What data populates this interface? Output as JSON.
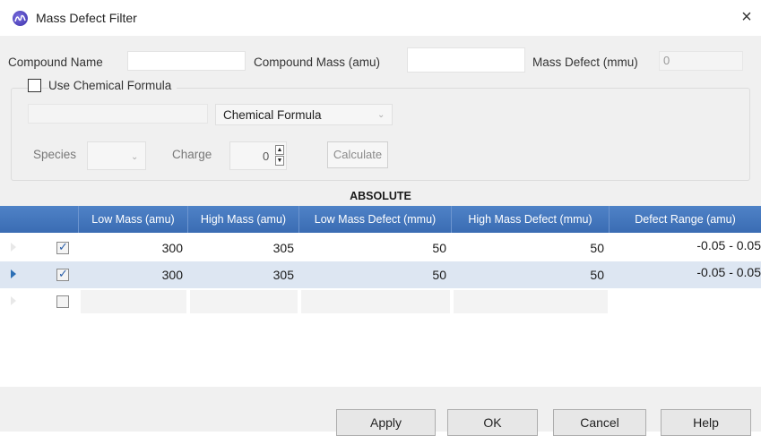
{
  "window": {
    "title": "Mass Defect Filter",
    "close_glyph": "×"
  },
  "compound": {
    "name_label": "Compound Name",
    "name_value": "",
    "mass_label": "Compound Mass (amu)",
    "mass_value": "",
    "defect_label": "Mass Defect (mmu)",
    "defect_value": "0"
  },
  "formula": {
    "use_label": "Use Chemical Formula",
    "use_checked": false,
    "formula_value": "",
    "type_selected": "Chemical Formula",
    "species_label": "Species",
    "species_value": "",
    "charge_label": "Charge",
    "charge_value": "0",
    "calculate_label": "Calculate"
  },
  "table": {
    "section_title": "ABSOLUTE",
    "columns": [
      "Low Mass (amu)",
      "High Mass (amu)",
      "Low Mass Defect (mmu)",
      "High Mass Defect (mmu)",
      "Defect Range (amu)"
    ],
    "rows": [
      {
        "checked": true,
        "low_mass": "300",
        "high_mass": "305",
        "low_defect": "50",
        "high_defect": "50",
        "range": "-0.05 - 0.05",
        "selected": false
      },
      {
        "checked": true,
        "low_mass": "300",
        "high_mass": "305",
        "low_defect": "50",
        "high_defect": "50",
        "range": "-0.05 - 0.05",
        "selected": true
      },
      {
        "checked": false,
        "low_mass": "",
        "high_mass": "",
        "low_defect": "",
        "high_defect": "",
        "range": "",
        "selected": false
      }
    ]
  },
  "buttons": {
    "apply": "Apply",
    "ok": "OK",
    "cancel": "Cancel",
    "help": "Help"
  },
  "colors": {
    "header_blue": "#4a7dc2",
    "selected_row": "#dde6f2",
    "row_indicator": "#2c6fb5"
  }
}
